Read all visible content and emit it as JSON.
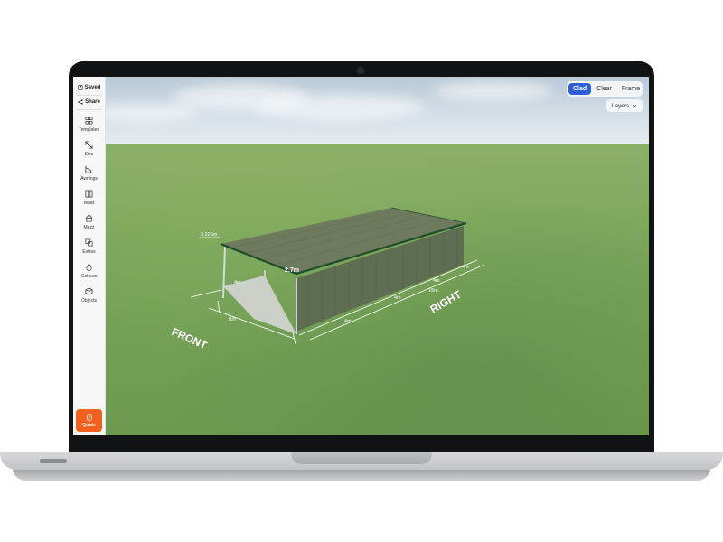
{
  "sidebar": {
    "saved_label": "Saved",
    "share_label": "Share",
    "items": [
      {
        "label": "Templates",
        "icon": "grid-icon"
      },
      {
        "label": "Size",
        "icon": "resize-icon"
      },
      {
        "label": "Awnings",
        "icon": "awning-icon"
      },
      {
        "label": "Walls",
        "icon": "wall-icon"
      },
      {
        "label": "Mezz",
        "icon": "home-icon"
      },
      {
        "label": "Extras",
        "icon": "extras-icon"
      },
      {
        "label": "Colours",
        "icon": "droplet-icon"
      },
      {
        "label": "Objects",
        "icon": "cube-icon"
      }
    ],
    "quote_label": "Quote",
    "accent": "#f0601e"
  },
  "view_toggle": {
    "options": [
      "Clad",
      "Clear",
      "Frame"
    ],
    "selected": "Clad",
    "accent": "#2f5fd6"
  },
  "layers_label": "Layers",
  "scene": {
    "dimensions": {
      "eave_height": "3.225m",
      "awning_height": "2.7m",
      "front_width": "6m",
      "awning_depth": "4m",
      "bay_1": "4m",
      "bay_2": "4m",
      "bay_3": "4m",
      "bay_4": "4m",
      "total_length": "16m"
    },
    "side_labels": {
      "front": "FRONT",
      "right": "RIGHT"
    },
    "colors": {
      "roof": "#6f7a5c",
      "wall": "#5f6d52",
      "trim": "#1e4d2b"
    }
  }
}
